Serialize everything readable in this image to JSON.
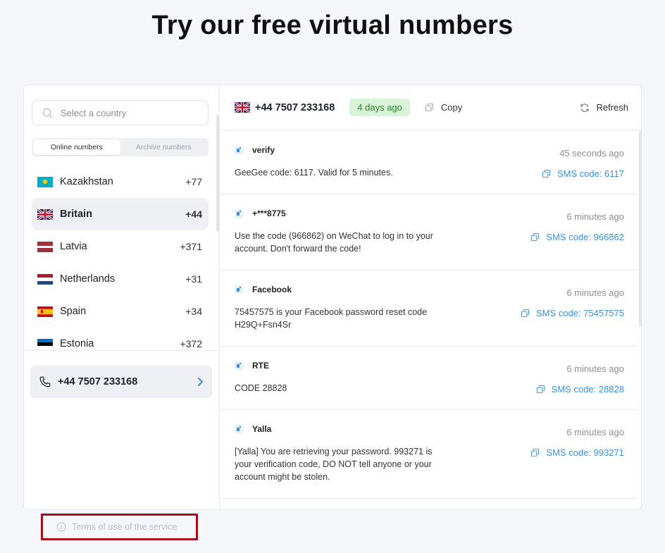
{
  "page": {
    "title": "Try our free virtual numbers"
  },
  "left": {
    "search": {
      "placeholder": "Select a country",
      "icon": "search-icon"
    },
    "tabs": [
      {
        "label": "Online numbers",
        "active": true
      },
      {
        "label": "Archive numbers",
        "active": false
      }
    ],
    "countries": [
      {
        "name": "Kazakhstan",
        "code": "+77",
        "flag": "kz"
      },
      {
        "name": "Britain",
        "code": "+44",
        "flag": "gb",
        "active": true
      },
      {
        "name": "Latvia",
        "code": "+371",
        "flag": "lv"
      },
      {
        "name": "Netherlands",
        "code": "+31",
        "flag": "nl"
      },
      {
        "name": "Spain",
        "code": "+34",
        "flag": "es"
      },
      {
        "name": "Estonia",
        "code": "+372",
        "flag": "ee"
      }
    ],
    "selected_number": {
      "number": "+44 7507 233168",
      "icon": "phone-icon",
      "chevron": "chevron-right-icon"
    }
  },
  "right": {
    "header": {
      "flag": "gb",
      "number": "+44 7507 233168",
      "age_badge": "4 days ago",
      "copy_label": "Copy",
      "refresh_label": "Refresh"
    },
    "messages": [
      {
        "sender": "verify",
        "time": "45 seconds ago",
        "text": "GeeGee code: 6117. Valid for 5 minutes.",
        "code": "SMS code: 6117"
      },
      {
        "sender": "+***8775",
        "time": "6 minutes ago",
        "text": "Use the code (966862) on WeChat to log in to your account. Don't forward the code!",
        "code": "SMS code: 966862"
      },
      {
        "sender": "Facebook",
        "time": "6 minutes ago",
        "text": "75457575 is your Facebook password reset code H29Q+Fsn4Sr",
        "code": "SMS code: 75457575"
      },
      {
        "sender": "RTE",
        "time": "6 minutes ago",
        "text": "CODE 28828",
        "code": "SMS code: 28828"
      },
      {
        "sender": "Yalla",
        "time": "6 minutes ago",
        "text": "[Yalla] You are retrieving your password. 993271 is your verification code, DO NOT tell anyone or your account might be stolen.",
        "code": "SMS code: 993271"
      }
    ]
  },
  "footer": {
    "terms_label": "Terms of use of the service",
    "icon": "info-icon"
  },
  "colors": {
    "accent": "#3b8fd6",
    "badge_bg": "#d9f3d9",
    "badge_text": "#2e7d32",
    "highlight_border": "#a5101e"
  }
}
